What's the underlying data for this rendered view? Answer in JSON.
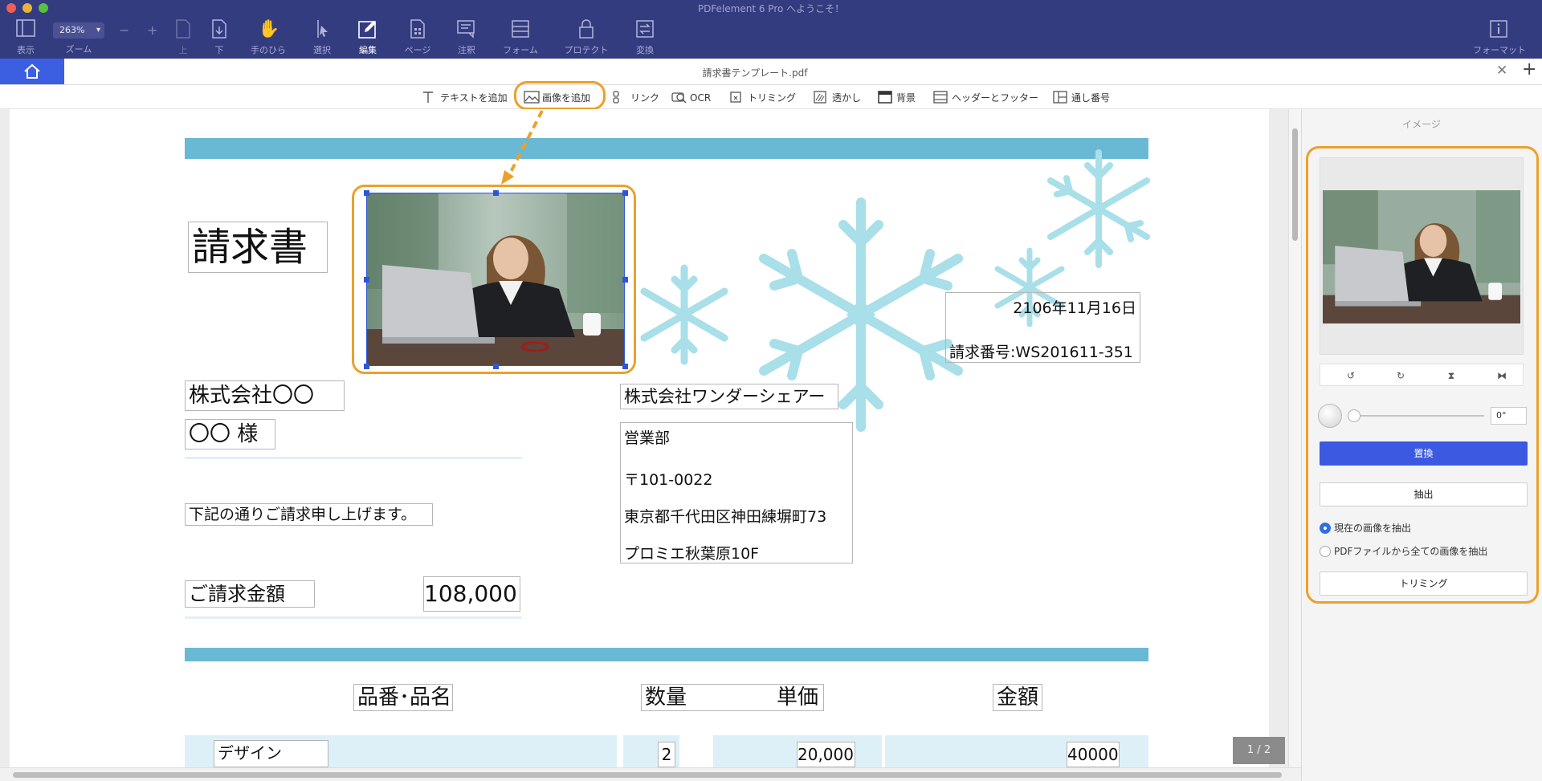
{
  "window": {
    "title": "PDFelement 6 Pro へようこそ！"
  },
  "toolbar": {
    "zoom_value": "263%",
    "zoom_label": "ズーム",
    "view_label": "表示",
    "up_label": "上",
    "down_label": "下",
    "hand_label": "手のひら",
    "select_label": "選択",
    "edit_label": "編集",
    "page_label": "ページ",
    "comment_label": "注釈",
    "form_label": "フォーム",
    "protect_label": "プロテクト",
    "convert_label": "変換",
    "format_label": "フォーマット"
  },
  "tabs": {
    "file_title": "請求書テンプレート.pdf"
  },
  "edit_toolbar": {
    "add_text": "テキストを追加",
    "add_image": "画像を追加",
    "link": "リンク",
    "ocr": "OCR",
    "crop": "トリミング",
    "watermark": "透かし",
    "background": "背景",
    "header_footer": "ヘッダーとフッター",
    "bates": "通し番号"
  },
  "document": {
    "title": "請求書",
    "date": "2106年11月16日",
    "invoice_no": "請求番号:WS201611-351",
    "client_company": "株式会社〇〇",
    "client_person": "〇〇 様",
    "sender_company": "株式会社ワンダーシェアー",
    "sender_dept": "営業部",
    "sender_zip": "〒101-0022",
    "sender_address1": "東京都千代田区神田練塀町73",
    "sender_address2": "プロミエ秋葉原10F",
    "message": "下記の通りご請求申し上げます。",
    "amount_label": "ご請求金額",
    "amount_value": "108,000",
    "col_item": "品番･品名",
    "col_qty": "数量",
    "col_price": "単価",
    "col_total": "金額",
    "row1": {
      "item": "デザイン",
      "qty": "2",
      "price": "20,000",
      "total": "40000"
    }
  },
  "page_indicator": "1 / 2",
  "right_panel": {
    "title": "イメージ",
    "rotation_value": "0°",
    "replace_button": "置換",
    "extract_button": "抽出",
    "extract_current": "現在の画像を抽出",
    "extract_all": "PDFファイルから全ての画像を抽出",
    "crop_button": "トリミング"
  },
  "colors": {
    "toolbar_bg": "#343c80",
    "accent_blue": "#3b5ae1",
    "highlight_orange": "#eba12a",
    "band_blue": "#6ab9d4",
    "snowflake": "#a8dfe9"
  }
}
